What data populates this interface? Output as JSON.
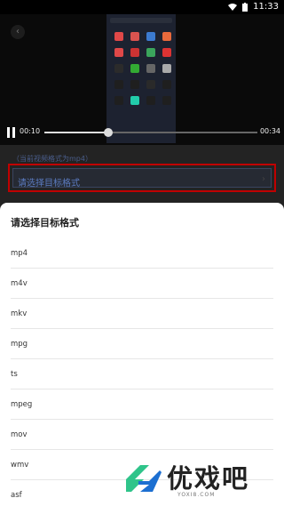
{
  "status_bar": {
    "time": "11:33"
  },
  "player": {
    "current_time": "00:10",
    "total_time": "00:34",
    "progress": 0.3
  },
  "format_panel": {
    "current_format_text": "（当前视频格式为mp4）",
    "select_placeholder": "请选择目标格式"
  },
  "sheet": {
    "title": "请选择目标格式",
    "options": [
      "mp4",
      "m4v",
      "mkv",
      "mpg",
      "ts",
      "mpeg",
      "mov",
      "wmv",
      "asf"
    ]
  },
  "watermark": {
    "brand": "优戏吧",
    "url": "YOXI8.COM"
  },
  "colors": {
    "accent": "#5b7bc0",
    "highlight_border": "#c00000",
    "watermark_green": "#2fc48a",
    "watermark_blue": "#1c6fd1"
  }
}
